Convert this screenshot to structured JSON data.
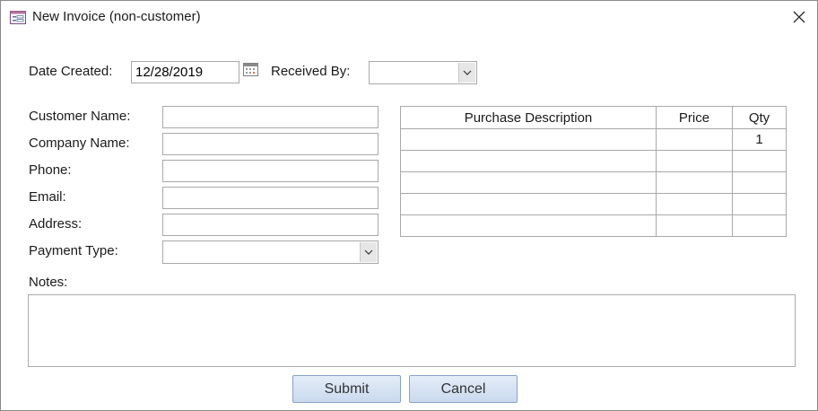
{
  "window": {
    "title": "New Invoice (non-customer)",
    "icon": "form-icon"
  },
  "header": {
    "date_created_label": "Date Created:",
    "date_created_value": "12/28/2019",
    "received_by_label": "Received By:",
    "received_by_value": ""
  },
  "customer": {
    "name_label": "Customer Name:",
    "name_value": "",
    "company_label": "Company Name:",
    "company_value": "",
    "phone_label": "Phone:",
    "phone_value": "",
    "email_label": "Email:",
    "email_value": "",
    "address_label": "Address:",
    "address_value": "",
    "payment_type_label": "Payment Type:",
    "payment_type_value": ""
  },
  "purchases": {
    "columns": [
      "Purchase Description",
      "Price",
      "Qty"
    ],
    "rows": [
      [
        "",
        "",
        "1"
      ],
      [
        "",
        "",
        ""
      ],
      [
        "",
        "",
        ""
      ],
      [
        "",
        "",
        ""
      ],
      [
        "",
        "",
        ""
      ]
    ]
  },
  "notes": {
    "label": "Notes:",
    "value": ""
  },
  "actions": {
    "submit_label": "Submit",
    "cancel_label": "Cancel"
  },
  "colors": {
    "button_border": "#8aa2c8",
    "button_fill_top": "#e4edf8",
    "button_fill_bottom": "#c9d9ee",
    "field_border": "#a9a9a9"
  }
}
